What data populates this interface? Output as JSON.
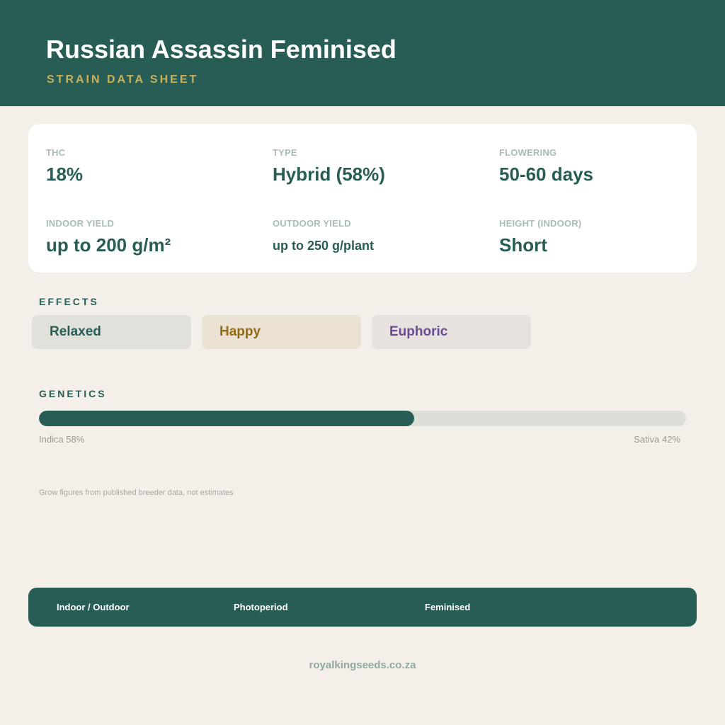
{
  "header": {
    "title": "Russian Assassin Feminised",
    "subtitle": "STRAIN DATA SHEET"
  },
  "stats": [
    {
      "label": "THC",
      "value": "18%"
    },
    {
      "label": "TYPE",
      "value": "Hybrid (58%)"
    },
    {
      "label": "FLOWERING",
      "value": "50-60 days"
    },
    {
      "label": "INDOOR YIELD",
      "value": "up to 200 g/m²"
    },
    {
      "label": "OUTDOOR YIELD",
      "value": "up to 250 g/plant"
    },
    {
      "label": "HEIGHT (INDOOR)",
      "value": "Short"
    }
  ],
  "effects": {
    "heading": "EFFECTS",
    "items": [
      {
        "label": "Relaxed",
        "color": "#285d55",
        "background": "#e0e1db"
      },
      {
        "label": "Happy",
        "color": "#8f6b12",
        "background": "#ece2d3"
      },
      {
        "label": "Euphoric",
        "color": "#6b4b8f",
        "background": "#e7e1e0"
      }
    ]
  },
  "genetics": {
    "heading": "GENETICS",
    "indica_percent": 58,
    "indica_label": "Indica 58%",
    "sativa_label": "Sativa 42%"
  },
  "footnote": "Grow figures from published breeder data, not estimates",
  "footer": {
    "items": [
      "Indoor / Outdoor",
      "Photoperiod",
      "Feminised"
    ]
  },
  "website": "royalkingseeds.co.za",
  "colors": {
    "primary": "#285d55",
    "accent": "#c9b15c",
    "background": "#f4efe9"
  }
}
